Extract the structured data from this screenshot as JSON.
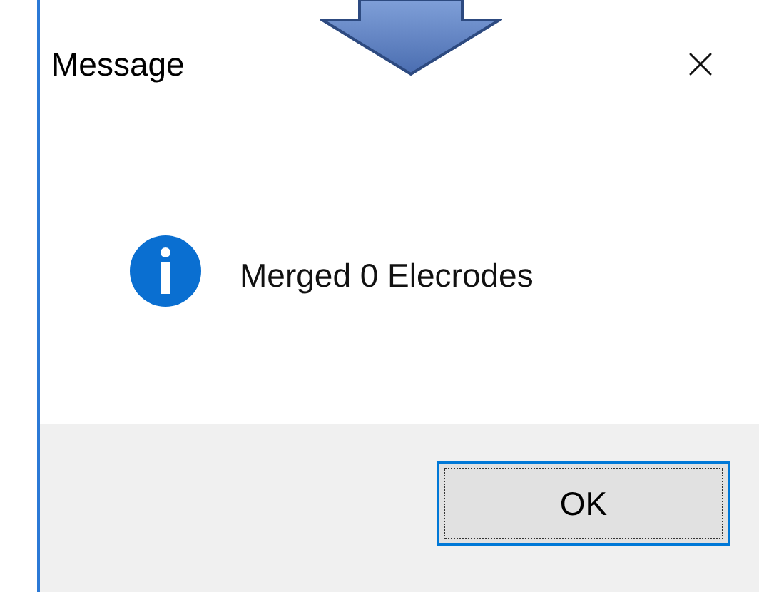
{
  "window": {
    "title": "Message"
  },
  "message": {
    "text": "Merged 0 Elecrodes",
    "kind": "info"
  },
  "buttons": [
    {
      "label": "OK",
      "focused": true
    }
  ]
}
